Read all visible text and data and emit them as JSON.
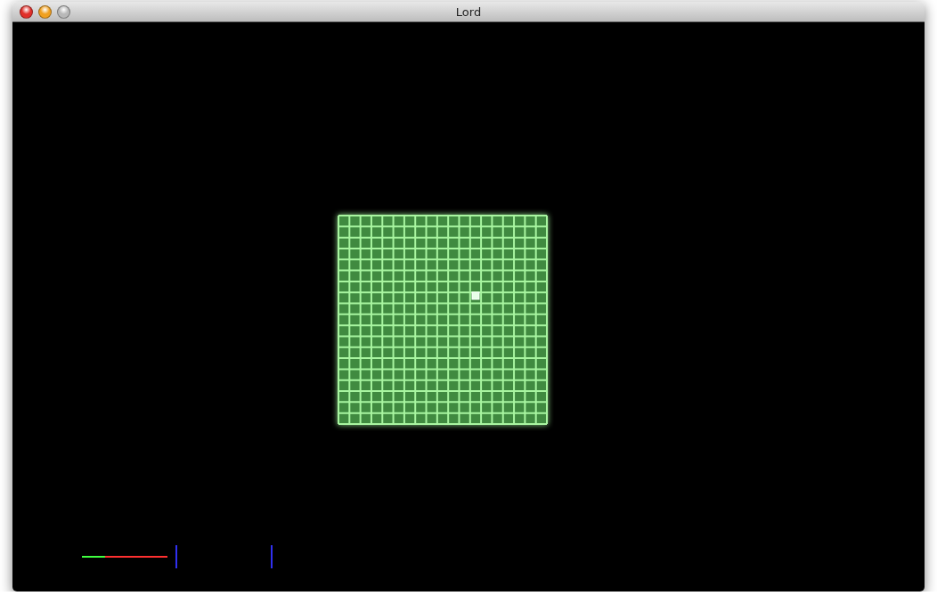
{
  "window": {
    "title": "Lord"
  },
  "hud": {
    "meter": {
      "level": 0.27
    }
  }
}
